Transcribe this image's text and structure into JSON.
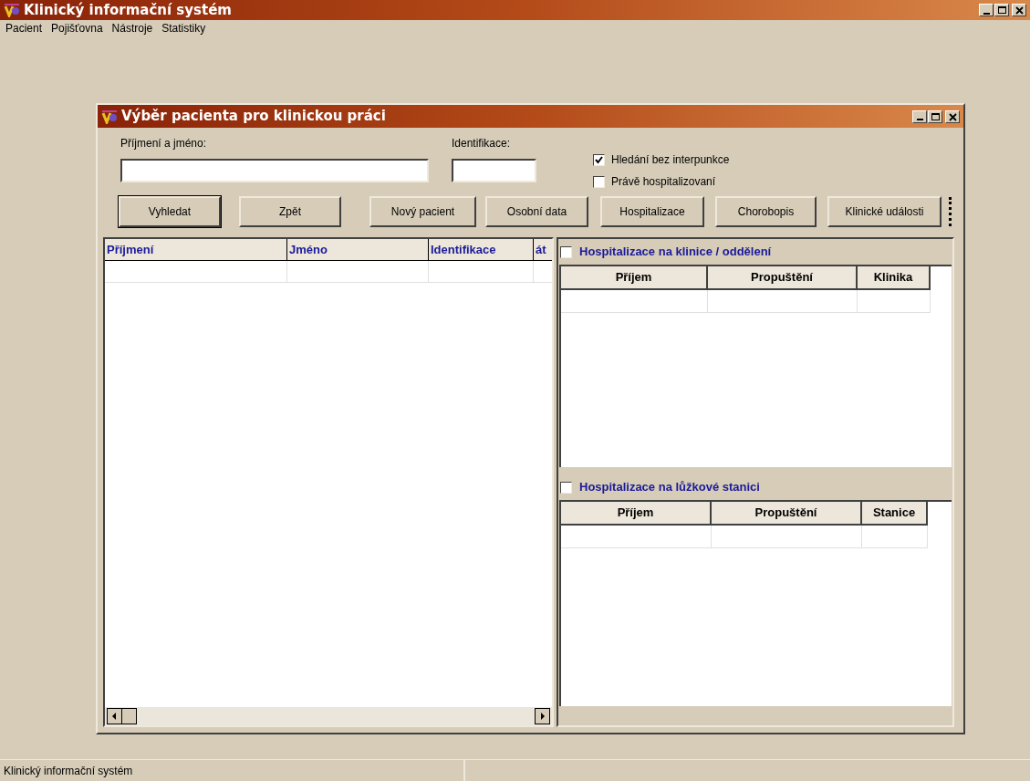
{
  "window": {
    "title": "Klinický informační systém"
  },
  "menu": [
    "Pacient",
    "Pojišťovna",
    "Nástroje",
    "Statistiky"
  ],
  "dialog": {
    "title": "Výběr pacienta pro klinickou práci",
    "fields": [
      {
        "label": "Příjmení a jméno:"
      },
      {
        "label": "Identifikace:"
      }
    ],
    "options": [
      {
        "label": "Hledání bez interpunkce",
        "checked": true
      },
      {
        "label": "Právě hospitalizovaní",
        "checked": false
      }
    ],
    "buttons": [
      {
        "label": "Vyhledat",
        "default": true
      },
      {
        "label": "Zpět",
        "default": false
      },
      {
        "label": "Nový pacient",
        "default": false
      },
      {
        "label": "Osobní data",
        "default": false
      },
      {
        "label": "Hospitalizace",
        "default": false
      },
      {
        "label": "Chorobopis",
        "default": false
      },
      {
        "label": "Klinické události",
        "default": false
      }
    ],
    "patients_table": {
      "columns": [
        "Příjmení",
        "Jméno",
        "Identifikace",
        "át"
      ]
    },
    "sections": [
      {
        "title": "Hospitalizace na klinice / oddělení",
        "checked": false,
        "columns": [
          "Příjem",
          "Propuštění",
          "Klinika"
        ]
      },
      {
        "title": "Hospitalizace na lůžkové stanici",
        "checked": false,
        "columns": [
          "Příjem",
          "Propuštění",
          "Stanice"
        ]
      }
    ]
  },
  "status_bar": [
    "Klinický informační systém"
  ]
}
